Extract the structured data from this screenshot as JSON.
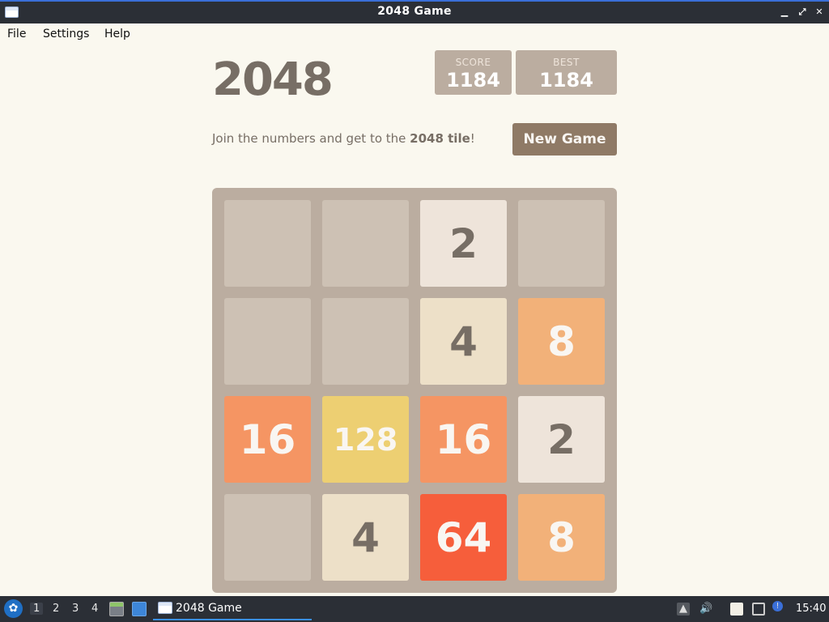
{
  "window": {
    "title": "2048 Game"
  },
  "menu": {
    "items": [
      "File",
      "Settings",
      "Help"
    ]
  },
  "game": {
    "title": "2048",
    "score_label": "SCORE",
    "score": "1184",
    "best_label": "BEST",
    "best": "1184",
    "intro_prefix": "Join the numbers and get to the ",
    "intro_bold": "2048 tile",
    "intro_suffix": "!",
    "new_game": "New Game",
    "grid": [
      [
        null,
        null,
        2,
        null
      ],
      [
        null,
        null,
        4,
        8
      ],
      [
        16,
        128,
        16,
        2
      ],
      [
        null,
        4,
        64,
        8
      ]
    ],
    "tile_colors": {
      "2": {
        "bg": "#eee4da",
        "fg": "#776e65"
      },
      "4": {
        "bg": "#ede0c8",
        "fg": "#776e65"
      },
      "8": {
        "bg": "#f2b179",
        "fg": "#f9f6f2"
      },
      "16": {
        "bg": "#f59563",
        "fg": "#f9f6f2"
      },
      "64": {
        "bg": "#f65e3b",
        "fg": "#f9f6f2"
      },
      "128": {
        "bg": "#edcf72",
        "fg": "#f9f6f2"
      }
    }
  },
  "taskbar": {
    "workspaces": [
      "1",
      "2",
      "3",
      "4"
    ],
    "active_workspace": "1",
    "task_title": "2048 Game",
    "clock": "15:40",
    "icons": [
      "start-menu-icon",
      "file-manager-icon",
      "desktop-icon",
      "up-arrow-icon",
      "volume-icon",
      "clipboard-icon",
      "network-icon",
      "update-notification-icon"
    ]
  }
}
